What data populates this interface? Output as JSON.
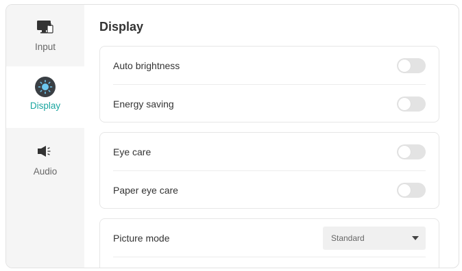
{
  "sidebar": {
    "items": [
      {
        "label": "Input",
        "icon": "monitor-input-icon",
        "active": false
      },
      {
        "label": "Display",
        "icon": "brightness-icon",
        "active": true
      },
      {
        "label": "Audio",
        "icon": "speaker-icon",
        "active": false
      }
    ]
  },
  "main": {
    "title": "Display",
    "groups": [
      {
        "rows": [
          {
            "label": "Auto brightness",
            "control": "toggle",
            "on": false
          },
          {
            "label": "Energy saving",
            "control": "toggle",
            "on": false
          }
        ]
      },
      {
        "rows": [
          {
            "label": "Eye care",
            "control": "toggle",
            "on": false
          },
          {
            "label": "Paper eye care",
            "control": "toggle",
            "on": false
          }
        ]
      },
      {
        "rows": [
          {
            "label": "Picture mode",
            "control": "select",
            "value": "Standard"
          }
        ]
      }
    ]
  },
  "colors": {
    "accent": "#1aa6a0",
    "sidebar_bg": "#f5f5f5",
    "toggle_off": "#e3e3e3"
  }
}
